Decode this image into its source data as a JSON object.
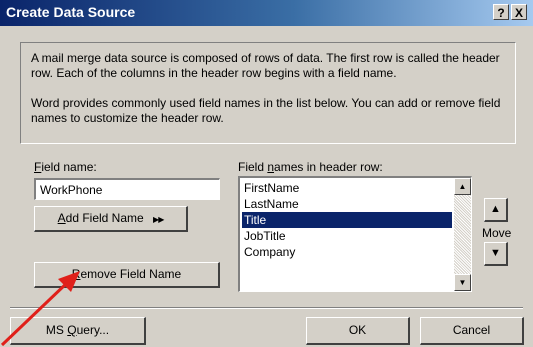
{
  "window": {
    "title": "Create Data Source",
    "help_glyph": "?",
    "close_glyph": "X"
  },
  "info": {
    "paragraph1": "A mail merge data source is composed of rows of data. The first row is called the header row. Each of the columns in the header row begins with a field name.",
    "paragraph2": "Word provides commonly used field names in the list below. You can add or remove field names to customize the header row."
  },
  "field_name": {
    "label_mnemonic": "F",
    "label_rest": "ield name:",
    "value": "WorkPhone"
  },
  "header_list": {
    "label_before": "Field ",
    "label_mnemonic": "n",
    "label_after": "ames in header row:",
    "items": [
      "FirstName",
      "LastName",
      "Title",
      "JobTitle",
      "Company"
    ],
    "selected_index": 2
  },
  "buttons": {
    "add_field_mnemonic": "A",
    "add_field_rest": "dd Field Name",
    "add_field_glyph": "▶▶",
    "remove_field_mnemonic": "R",
    "remove_field_rest": "emove Field Name",
    "ms_query_before": "MS ",
    "ms_query_mnemonic": "Q",
    "ms_query_after": "uery...",
    "ok": "OK",
    "cancel": "Cancel"
  },
  "move": {
    "label": "Move",
    "up_glyph": "▲",
    "down_glyph": "▼",
    "scroll_up_glyph": "▲",
    "scroll_down_glyph": "▼"
  },
  "colors": {
    "selection": "#0a246a",
    "annotation_arrow": "#e0201a"
  }
}
